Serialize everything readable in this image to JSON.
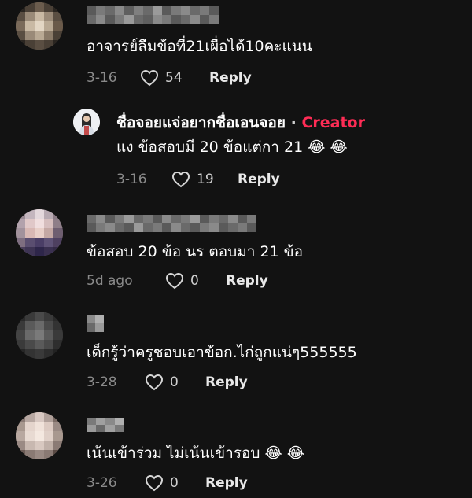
{
  "comments": [
    {
      "username": "",
      "text": "อาจารย์ลืมข้อที่21เผื่อได้10คะแนน",
      "date": "3-16",
      "likes": "54",
      "reply_label": "Reply",
      "reply": {
        "username": "ชื่อจอยแจ่อยากชื่อเอนจอย",
        "separator": "·",
        "badge": "Creator",
        "text": "แง ข้อสอบมี 20 ข้อแต่กา 21 😂 😂",
        "date": "3-16",
        "likes": "19",
        "reply_label": "Reply"
      }
    },
    {
      "username": "",
      "text": "ข้อสอบ 20 ข้อ นร ตอบมา 21 ข้อ",
      "date": "5d ago",
      "likes": "0",
      "reply_label": "Reply"
    },
    {
      "username": "",
      "text": "เด็กรู้ว่าครูชอบเอาข้อก.ไก่ถูกแน่ๆ555555",
      "date": "3-28",
      "likes": "0",
      "reply_label": "Reply"
    },
    {
      "username": "",
      "text": "เน้นเข้าร่วม ไม่เน้นเข้ารอบ 😂 😂",
      "date": "3-26",
      "likes": "0",
      "reply_label": "Reply"
    }
  ],
  "colors": {
    "background": "#121212",
    "creator_badge": "#fe2c55",
    "meta_text": "#8a8a8a"
  },
  "icons": {
    "like": "heart-outline-icon"
  }
}
